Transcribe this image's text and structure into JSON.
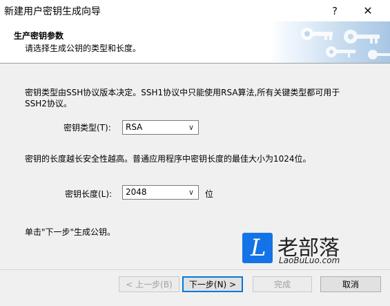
{
  "window": {
    "title": "新建用户密钥生成向导",
    "help": "?",
    "close": "✕"
  },
  "header": {
    "title": "生产密钥参数",
    "subtitle": "请选择生成公钥的类型和长度。"
  },
  "content": {
    "type_info_line1": "密钥类型由SSH协议版本决定。SSH1协议中只能使用RSA算法,所有关键类型都可用于",
    "type_info_line2": "SSH2协议。",
    "type_label": "密钥类型(T):",
    "type_value": "RSA",
    "length_info": "密钥的长度越长安全性越高。普通应用程序中密钥长度的最佳大小为1024位。",
    "length_label": "密钥长度(L):",
    "length_value": "2048",
    "length_unit": "位",
    "next_hint": "单击\"下一步\"生成公钥。"
  },
  "buttons": {
    "back": "< 上一步(B)",
    "next": "下一步(N) >",
    "finish": "完成",
    "cancel": "取消"
  },
  "watermark": {
    "logo_letter": "L",
    "site_cn": "老部落",
    "site_en": "LaoBuLuo.com"
  }
}
